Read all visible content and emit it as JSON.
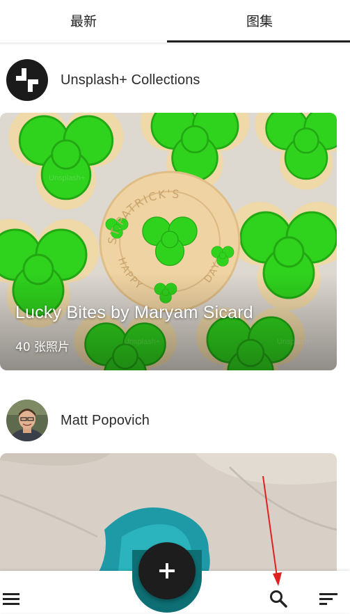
{
  "tabs": [
    {
      "label": "最新",
      "active": false
    },
    {
      "label": "图集",
      "active": true
    }
  ],
  "collections": [
    {
      "owner": "Unsplash+ Collections",
      "title": "Lucky Bites by Maryam Sicard",
      "count": "40 张照片",
      "image": "green-shamrock-cookies",
      "cookie_text_top": "ST.PATRICK'S",
      "cookie_text_bottom": "HAPPY",
      "cookie_text_right": "DAY",
      "watermark": "Unsplash+"
    },
    {
      "owner": "Matt Popovich",
      "image": "turquoise-water-sand-aerial"
    }
  ],
  "bottom_bar": {
    "fab_icon": "plus-icon",
    "icons": [
      "menu-icon",
      "search-icon",
      "sort-icon"
    ]
  },
  "colors": {
    "fab": "#1d1d1d",
    "cradle": "#0d6f73",
    "tab_indicator": "#1f1f1f",
    "annotation_arrow": "#e02020",
    "cookie_green": "#2ccf1a"
  }
}
